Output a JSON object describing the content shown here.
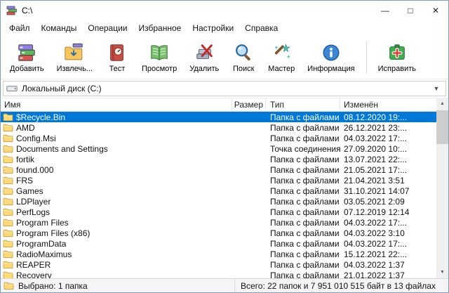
{
  "window": {
    "title": "C:\\"
  },
  "menu": {
    "items": [
      "Файл",
      "Команды",
      "Операции",
      "Избранное",
      "Настройки",
      "Справка"
    ]
  },
  "toolbar": {
    "buttons": [
      {
        "label": "Добавить",
        "icon": "add-archive-icon"
      },
      {
        "label": "Извлечь...",
        "icon": "extract-icon"
      },
      {
        "label": "Тест",
        "icon": "test-icon"
      },
      {
        "label": "Просмотр",
        "icon": "view-icon"
      },
      {
        "label": "Удалить",
        "icon": "delete-icon"
      },
      {
        "label": "Поиск",
        "icon": "search-icon"
      },
      {
        "label": "Мастер",
        "icon": "wizard-icon"
      },
      {
        "label": "Информация",
        "icon": "info-icon"
      },
      {
        "label": "Исправить",
        "icon": "repair-icon",
        "separator_before": true
      }
    ]
  },
  "address_bar": {
    "value": "Локальный диск (C:)"
  },
  "file_list": {
    "columns": [
      "Имя",
      "Размер",
      "Тип",
      "Изменён"
    ],
    "rows": [
      {
        "name": "$Recycle.Bin",
        "size": "",
        "type": "Папка с файлами",
        "modified": "08.12.2020 19:...",
        "selected": true
      },
      {
        "name": "AMD",
        "size": "",
        "type": "Папка с файлами",
        "modified": "26.12.2021 23:..."
      },
      {
        "name": "Config.Msi",
        "size": "",
        "type": "Папка с файлами",
        "modified": "04.03.2022 17:..."
      },
      {
        "name": "Documents and Settings",
        "size": "",
        "type": "Точка соединения",
        "modified": "27.09.2020 10:..."
      },
      {
        "name": "fortik",
        "size": "",
        "type": "Папка с файлами",
        "modified": "13.07.2021 22:..."
      },
      {
        "name": "found.000",
        "size": "",
        "type": "Папка с файлами",
        "modified": "21.05.2021 17:..."
      },
      {
        "name": "FRS",
        "size": "",
        "type": "Папка с файлами",
        "modified": "21.04.2021 3:51"
      },
      {
        "name": "Games",
        "size": "",
        "type": "Папка с файлами",
        "modified": "31.10.2021 14:07"
      },
      {
        "name": "LDPlayer",
        "size": "",
        "type": "Папка с файлами",
        "modified": "03.05.2021 2:09"
      },
      {
        "name": "PerfLogs",
        "size": "",
        "type": "Папка с файлами",
        "modified": "07.12.2019 12:14"
      },
      {
        "name": "Program Files",
        "size": "",
        "type": "Папка с файлами",
        "modified": "04.03.2022 17:..."
      },
      {
        "name": "Program Files (x86)",
        "size": "",
        "type": "Папка с файлами",
        "modified": "04.03.2022 3:10"
      },
      {
        "name": "ProgramData",
        "size": "",
        "type": "Папка с файлами",
        "modified": "04.03.2022 17:..."
      },
      {
        "name": "RadioMaximus",
        "size": "",
        "type": "Папка с файлами",
        "modified": "15.12.2021 22:..."
      },
      {
        "name": "REAPER",
        "size": "",
        "type": "Папка с файлами",
        "modified": "04.03.2022 1:37"
      },
      {
        "name": "Recovery",
        "size": "",
        "type": "Папка с файлами",
        "modified": "21.01.2022 1:37"
      }
    ]
  },
  "status_bar": {
    "left": "Выбрано: 1 папка",
    "right": "Всего: 22 папок и 7 951 010 515 байт в 13 файлах"
  }
}
